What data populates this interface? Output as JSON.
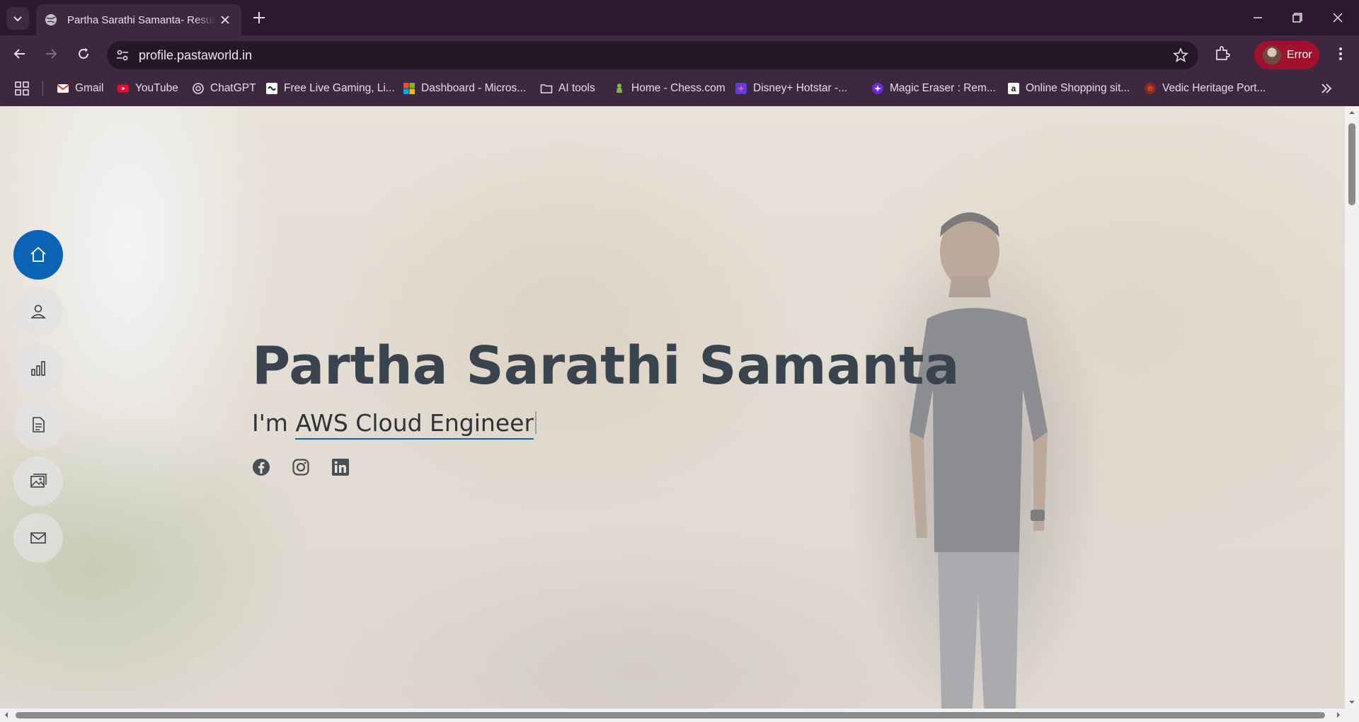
{
  "browser": {
    "tab_title": "Partha Sarathi Samanta- Resume",
    "url": "profile.pastaworld.in",
    "profile_label": "Error"
  },
  "bookmarks": [
    {
      "label": "Gmail",
      "icon": "gmail-icon"
    },
    {
      "label": "YouTube",
      "icon": "youtube-icon"
    },
    {
      "label": "ChatGPT",
      "icon": "chatgpt-icon"
    },
    {
      "label": "Free Live Gaming, Li...",
      "icon": "gaming-icon"
    },
    {
      "label": "Dashboard - Micros...",
      "icon": "microsoft-icon"
    },
    {
      "label": "AI tools",
      "icon": "folder-icon"
    },
    {
      "label": "Home - Chess.com",
      "icon": "chess-icon"
    },
    {
      "label": "Disney+ Hotstar -...",
      "icon": "hotstar-icon"
    },
    {
      "label": "Magic Eraser : Rem...",
      "icon": "magic-eraser-icon"
    },
    {
      "label": "Online Shopping sit...",
      "icon": "amazon-icon"
    },
    {
      "label": "Vedic Heritage Port...",
      "icon": "vedic-icon"
    }
  ],
  "hero": {
    "name": "Partha Sarathi Samanta",
    "prefix": "I'm",
    "role": "AWS Cloud Engineer"
  },
  "side_nav": [
    "home-icon",
    "person-icon",
    "chart-icon",
    "document-icon",
    "gallery-icon",
    "mail-icon"
  ],
  "social": [
    "facebook-icon",
    "instagram-icon",
    "linkedin-icon"
  ],
  "colors": {
    "accent": "#0b63b6",
    "browser_frame": "#2b1a2e",
    "toolbar": "#3d2840",
    "profile_error": "#a1112e",
    "heading": "#39444f"
  }
}
